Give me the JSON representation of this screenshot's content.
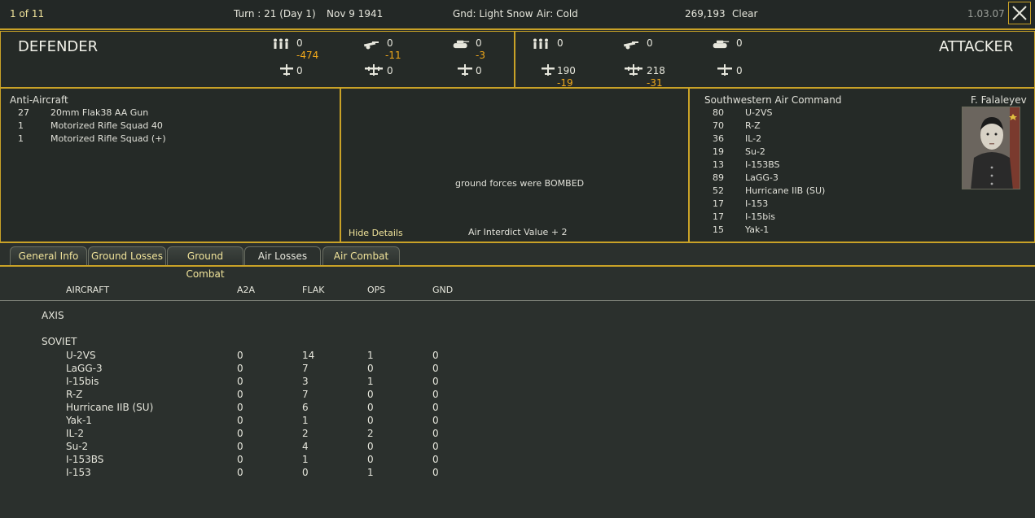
{
  "topbar": {
    "counter": "1 of 11",
    "turn": "Turn : 21 (Day 1)",
    "date": "Nov 9 1941",
    "ground": "Gnd: Light Snow",
    "air": "Air: Cold",
    "location": "269,193",
    "weather": "Clear",
    "version": "1.03.07"
  },
  "defender": {
    "title": "DEFENDER",
    "men": "0",
    "men_loss": "-474",
    "guns": "0",
    "guns_loss": "-11",
    "tanks": "0",
    "tanks_loss": "-3",
    "fighters": "0",
    "bombers": "0",
    "other_air": "0"
  },
  "attacker": {
    "title": "ATTACKER",
    "men": "0",
    "guns": "0",
    "tanks": "0",
    "fighters": "190",
    "fighters_loss": "-19",
    "bombers": "218",
    "bombers_loss": "-31",
    "other_air": "0"
  },
  "defender_units": {
    "header": "Anti-Aircraft",
    "items": [
      {
        "count": "27",
        "name": "20mm Flak38 AA Gun"
      },
      {
        "count": "1",
        "name": "Motorized Rifle Squad 40"
      },
      {
        "count": "1",
        "name": "Motorized Rifle Squad (+)"
      }
    ]
  },
  "center": {
    "message": "ground forces were BOMBED",
    "hide_details": "Hide Details",
    "interdict": "Air Interdict Value  + 2"
  },
  "attacker_units": {
    "header": "Southwestern Air Command",
    "commander": "F. Falaleyev",
    "items": [
      {
        "count": "80",
        "name": "U-2VS"
      },
      {
        "count": "70",
        "name": "R-Z"
      },
      {
        "count": "36",
        "name": "IL-2"
      },
      {
        "count": "19",
        "name": "Su-2"
      },
      {
        "count": "13",
        "name": "I-153BS"
      },
      {
        "count": "89",
        "name": "LaGG-3"
      },
      {
        "count": "52",
        "name": "Hurricane IIB (SU)"
      },
      {
        "count": "17",
        "name": "I-153"
      },
      {
        "count": "17",
        "name": "I-15bis"
      },
      {
        "count": "15",
        "name": "Yak-1"
      }
    ]
  },
  "tabs": [
    {
      "label": "General Info"
    },
    {
      "label": "Ground Losses"
    },
    {
      "label": "Ground Combat"
    },
    {
      "label": "Air Losses"
    },
    {
      "label": "Air Combat"
    }
  ],
  "losses_table": {
    "headers": {
      "aircraft": "AIRCRAFT",
      "a2a": "A2A",
      "flak": "FLAK",
      "ops": "OPS",
      "gnd": "GND"
    },
    "axis_label": "AXIS",
    "soviet_label": "SOVIET",
    "rows": [
      {
        "name": "U-2VS",
        "a2a": "0",
        "flak": "14",
        "ops": "1",
        "gnd": "0"
      },
      {
        "name": "LaGG-3",
        "a2a": "0",
        "flak": "7",
        "ops": "0",
        "gnd": "0"
      },
      {
        "name": "I-15bis",
        "a2a": "0",
        "flak": "3",
        "ops": "1",
        "gnd": "0"
      },
      {
        "name": "R-Z",
        "a2a": "0",
        "flak": "7",
        "ops": "0",
        "gnd": "0"
      },
      {
        "name": "Hurricane IIB (SU)",
        "a2a": "0",
        "flak": "6",
        "ops": "0",
        "gnd": "0"
      },
      {
        "name": "Yak-1",
        "a2a": "0",
        "flak": "1",
        "ops": "0",
        "gnd": "0"
      },
      {
        "name": "IL-2",
        "a2a": "0",
        "flak": "2",
        "ops": "2",
        "gnd": "0"
      },
      {
        "name": "Su-2",
        "a2a": "0",
        "flak": "4",
        "ops": "0",
        "gnd": "0"
      },
      {
        "name": "I-153BS",
        "a2a": "0",
        "flak": "1",
        "ops": "0",
        "gnd": "0"
      },
      {
        "name": "I-153",
        "a2a": "0",
        "flak": "0",
        "ops": "1",
        "gnd": "0"
      }
    ]
  },
  "icons": {
    "men": "infantry-icon",
    "guns": "gun-icon",
    "tanks": "tank-icon",
    "fighters": "fighter-icon",
    "bombers": "bomber-icon",
    "other_air": "plane-icon"
  },
  "colors": {
    "accent": "#c9a227",
    "loss": "#f0a81a",
    "tab_text": "#f0e39a"
  }
}
